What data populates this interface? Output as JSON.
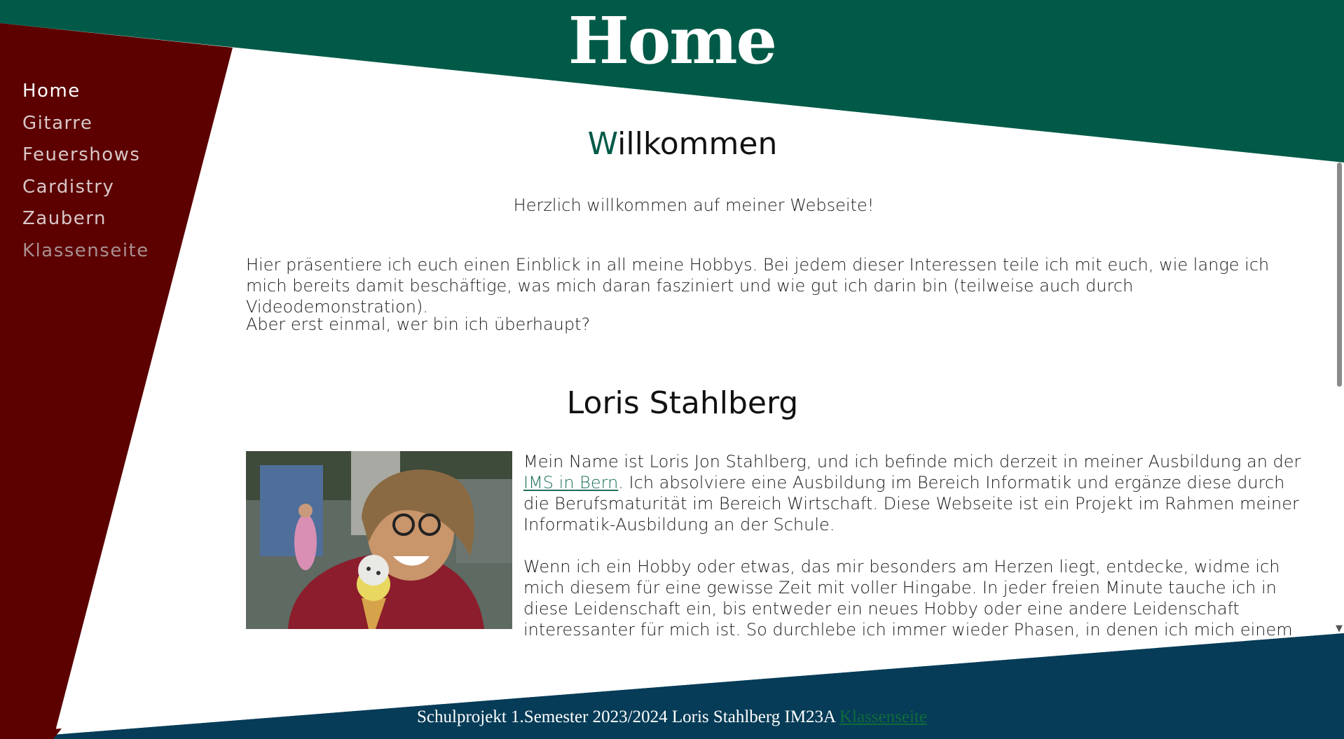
{
  "colors": {
    "header_green": "#005a47",
    "sidebar_red": "#5c0000",
    "footer_blue": "#063c57",
    "accent": "#005a47"
  },
  "header": {
    "title": "Home"
  },
  "nav": {
    "items": [
      {
        "label": "Home",
        "active": true
      },
      {
        "label": "Gitarre"
      },
      {
        "label": "Feuershows"
      },
      {
        "label": "Cardistry"
      },
      {
        "label": "Zaubern"
      },
      {
        "label": "Klassenseite"
      }
    ]
  },
  "main": {
    "welcome_heading_first": "W",
    "welcome_heading_rest": "illkommen",
    "welcome_text": "Herzlich willkommen auf meiner Webseite!",
    "intro": "Hier präsentiere ich euch einen Einblick in all meine Hobbys. Bei jedem dieser Interessen teile ich mit euch, wie lange ich mich bereits damit beschäftige, was mich daran fasziniert und wie gut ich darin bin (teilweise auch durch Videodemonstration).",
    "question": "Aber erst einmal, wer bin ich überhaupt?",
    "name_heading": "Loris Stahlberg",
    "bio_before_link": "Mein Name ist Loris Jon Stahlberg, und ich befinde mich derzeit in meiner Ausbildung an der ",
    "bio_link": "IMS in Bern",
    "bio_after_link": ". Ich absolviere eine Ausbildung im Bereich Informatik und ergänze diese durch die Berufsmaturität im Bereich Wirtschaft. Diese Webseite ist ein Projekt im Rahmen meiner Informatik-Ausbildung an der Schule.",
    "hobby_text": "Wenn ich ein Hobby oder etwas, das mir besonders am Herzen liegt, entdecke, widme ich mich diesem für eine gewisse Zeit mit voller Hingabe. In jeder freien Minute tauche ich in diese Leidenschaft ein, bis entweder ein neues Hobby oder eine andere Leidenschaft interessanter für mich ist. So durchlebe ich immer wieder Phasen, in denen ich mich einem bestimmten Hobby mit voller Leidenschaft und"
  },
  "footer": {
    "text": "Schulprojekt 1.Semester 2023/2024 Loris Stahlberg IM23A ",
    "link": "Klassenseite"
  }
}
